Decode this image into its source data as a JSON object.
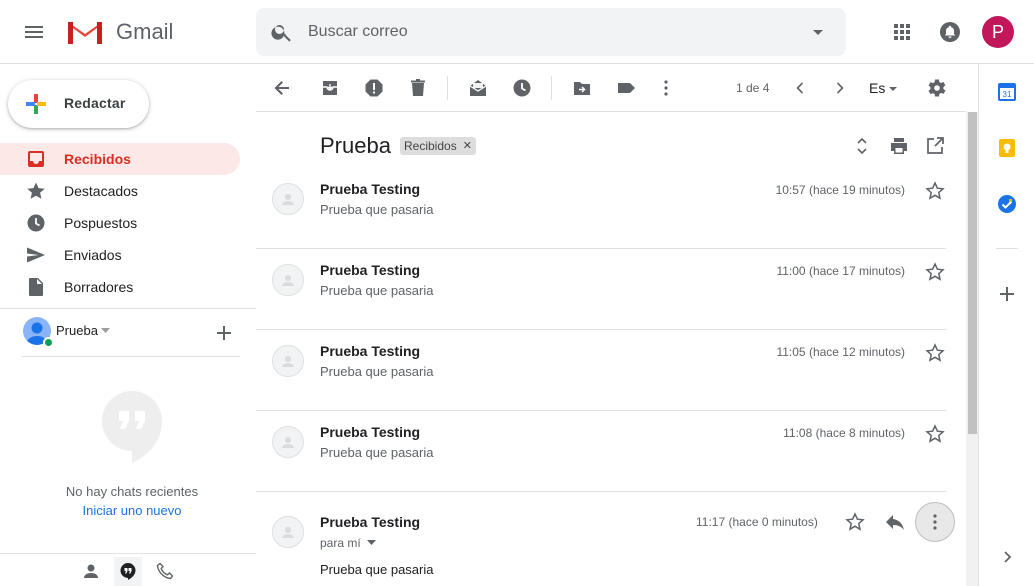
{
  "header": {
    "app_name": "Gmail",
    "search_placeholder": "Buscar correo",
    "account_initial": "P"
  },
  "sidebar": {
    "compose_label": "Redactar",
    "items": [
      {
        "label": "Recibidos",
        "icon": "inbox-icon",
        "active": true
      },
      {
        "label": "Destacados",
        "icon": "star-icon",
        "active": false
      },
      {
        "label": "Pospuestos",
        "icon": "clock-icon",
        "active": false
      },
      {
        "label": "Enviados",
        "icon": "send-icon",
        "active": false
      },
      {
        "label": "Borradores",
        "icon": "draft-icon",
        "active": false
      }
    ],
    "hangouts": {
      "user_name": "Prueba",
      "no_chats": "No hay chats recientes",
      "start_new": "Iniciar uno nuevo"
    }
  },
  "toolbar": {
    "pager": "1 de 4",
    "language": "Es"
  },
  "thread": {
    "subject": "Prueba",
    "label": "Recibidos",
    "messages": [
      {
        "sender": "Prueba Testing",
        "snippet": "Prueba que pasaria",
        "time": "10:57 (hace 19 minutos)"
      },
      {
        "sender": "Prueba Testing",
        "snippet": "Prueba que pasaria",
        "time": "11:00 (hace 17 minutos)"
      },
      {
        "sender": "Prueba Testing",
        "snippet": "Prueba que pasaria",
        "time": "11:05 (hace 12 minutos)"
      },
      {
        "sender": "Prueba Testing",
        "snippet": "Prueba que pasaria",
        "time": "11:08 (hace 8 minutos)"
      }
    ],
    "last_message": {
      "sender": "Prueba Testing",
      "time": "11:17 (hace 0 minutos)",
      "to": "para mí",
      "body": "Prueba que pasaria"
    }
  },
  "side_panel": {
    "calendar_day": "31"
  },
  "colors": {
    "accent_red": "#d93025",
    "active_bg": "#fce8e6",
    "link_blue": "#1a73e8",
    "avatar_bg": "#c2185b"
  }
}
